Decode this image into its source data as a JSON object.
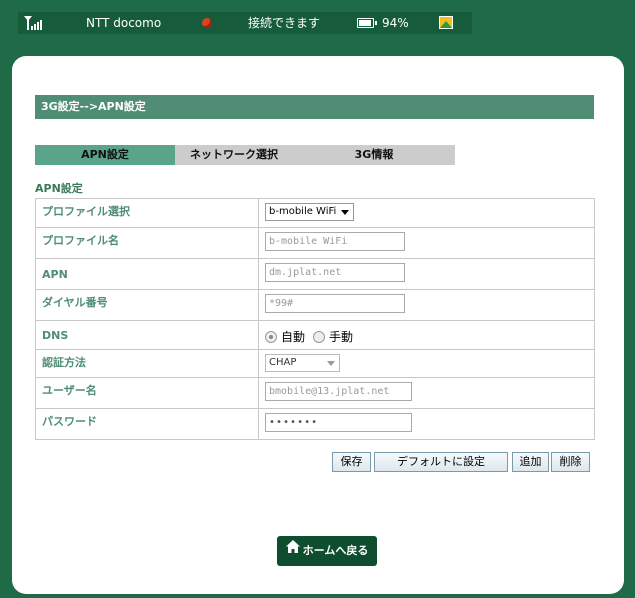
{
  "status": {
    "carrier": "NTT docomo",
    "connection": "接続できます",
    "battery": "94%",
    "battery_level": 0.94
  },
  "header": {
    "breadcrumb": "3G設定-->APN設定"
  },
  "tabs": [
    {
      "label": "APN設定",
      "active": true
    },
    {
      "label": "ネットワーク選択",
      "active": false
    },
    {
      "label": "3G情報",
      "active": false
    }
  ],
  "section_title": "APN設定",
  "form": {
    "profile_select": {
      "label": "プロファイル選択",
      "value": "b-mobile WiFi"
    },
    "profile_name": {
      "label": "プロファイル名",
      "placeholder": "b-mobile WiFi"
    },
    "apn": {
      "label": "APN",
      "placeholder": "dm.jplat.net"
    },
    "dial": {
      "label": "ダイヤル番号",
      "placeholder": "*99#"
    },
    "dns": {
      "label": "DNS",
      "option_auto": "自動",
      "option_manual": "手動",
      "selected": "自動"
    },
    "auth": {
      "label": "認証方法",
      "value": "CHAP"
    },
    "username": {
      "label": "ユーザー名",
      "placeholder": "bmobile@13.jplat.net"
    },
    "password": {
      "label": "パスワード",
      "value": "•••••••"
    }
  },
  "buttons": {
    "save": "保存",
    "default": "デフォルトに設定",
    "add": "追加",
    "delete": "削除"
  },
  "home_button": "ホームへ戻る"
}
